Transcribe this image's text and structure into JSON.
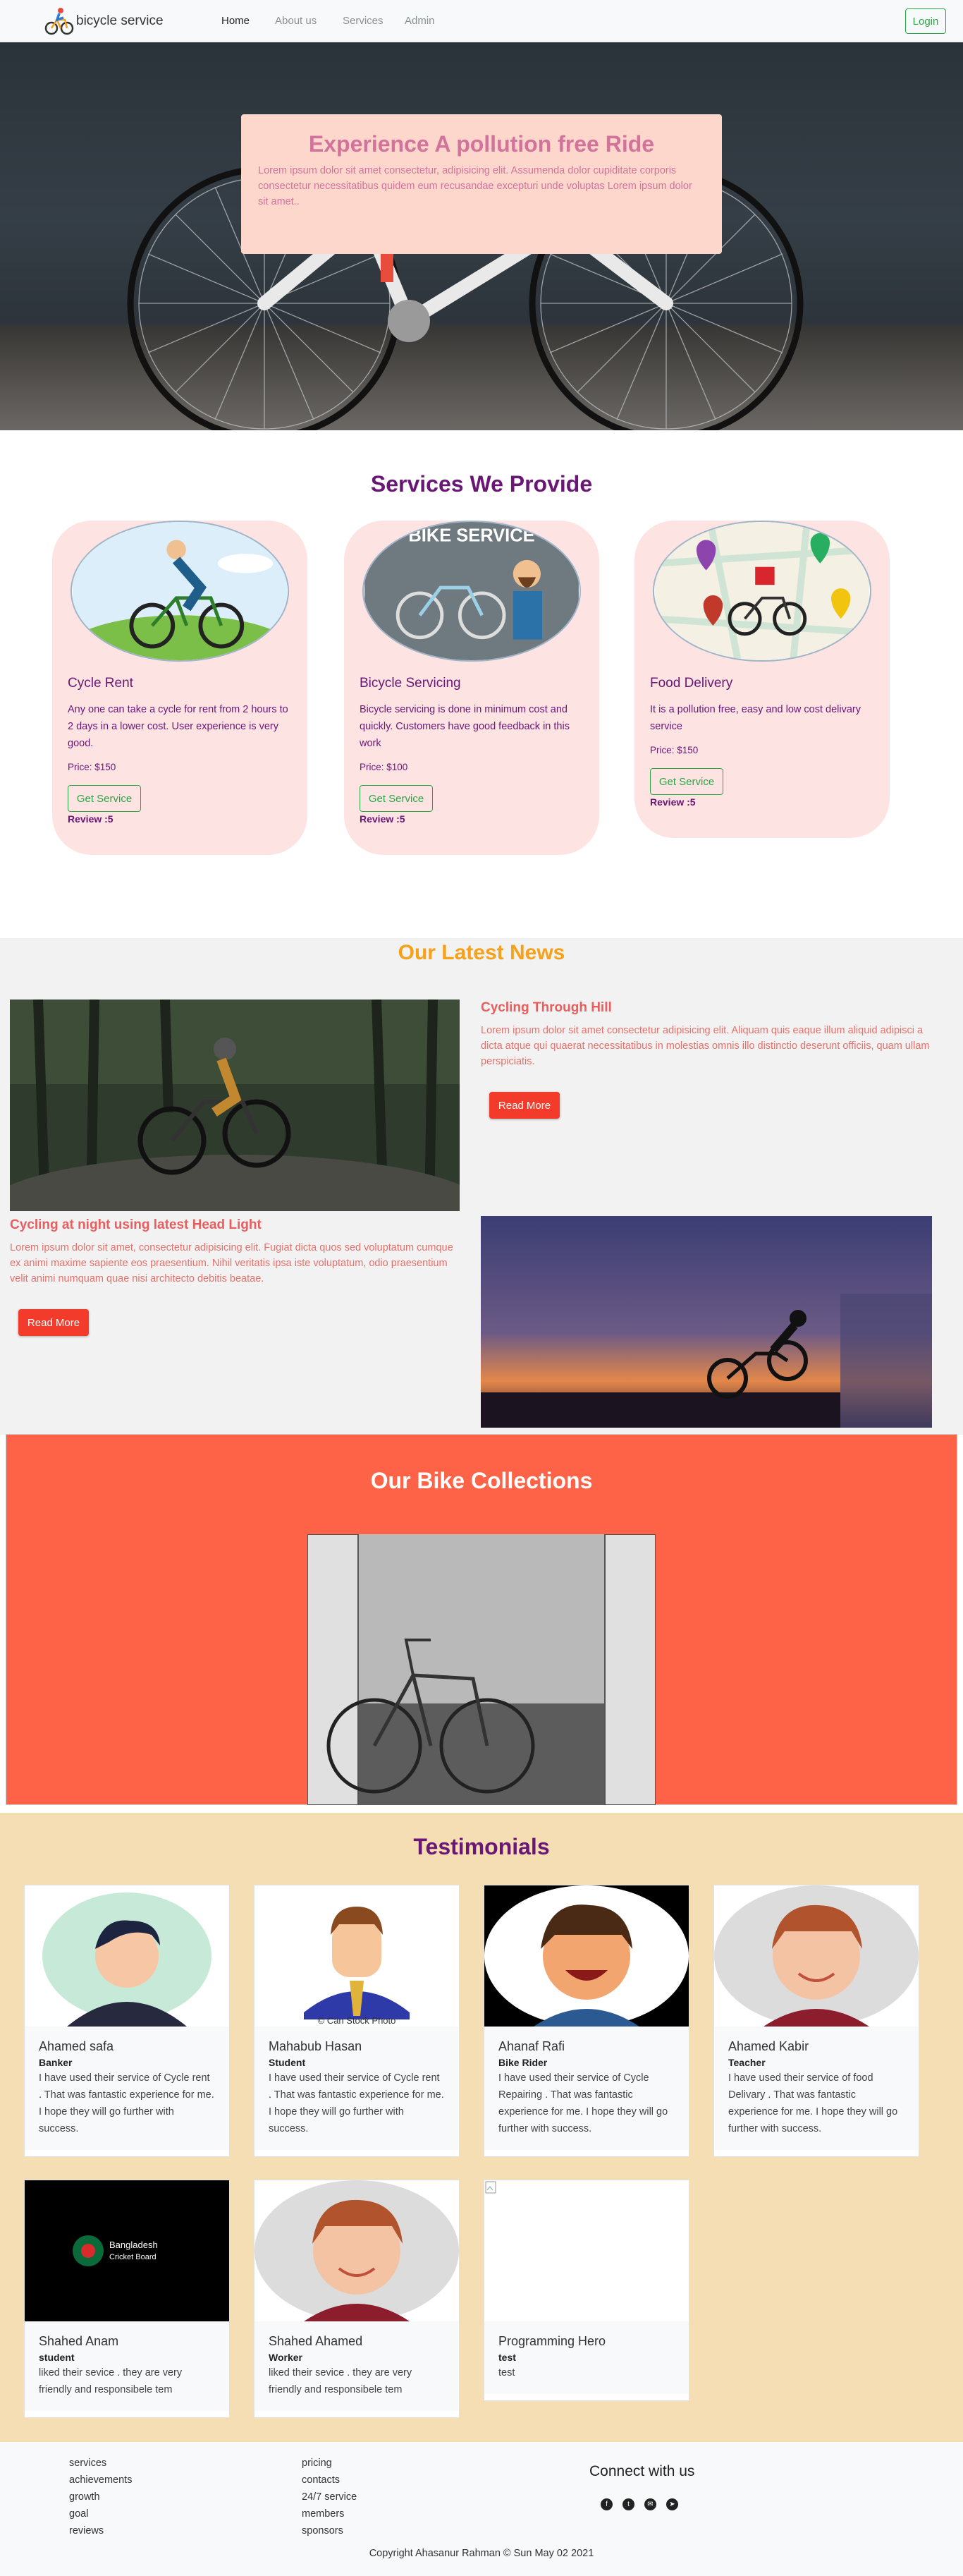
{
  "navbar": {
    "brand": "bicycle service",
    "links": [
      "Home",
      "About us",
      "Services",
      "Admin"
    ],
    "login": "Login"
  },
  "hero": {
    "title": "Experience A pollution free Ride",
    "text": "Lorem ipsum dolor sit amet consectetur, adipisicing elit. Assumenda dolor cupiditate corporis consectetur necessitatibus quidem eum recusandae excepturi unde voluptas Lorem ipsum dolor sit amet.."
  },
  "services": {
    "title": "Services We Provide",
    "image_labels": {
      "servicing": "BIKE SERVICE"
    },
    "items": [
      {
        "name": "Cycle Rent",
        "desc": "Any one can take a cycle for rent from 2 hours to 2 days in a lower cost. User experience is very good.",
        "price": "Price: $150",
        "button": "Get Service",
        "review": "Review :5"
      },
      {
        "name": "Bicycle Servicing",
        "desc": "Bicycle servicing is done in minimum cost and quickly. Customers have good feedback in this work",
        "price": "Price: $100",
        "button": "Get Service",
        "review": "Review :5"
      },
      {
        "name": "Food Delivery",
        "desc": "It is a pollution free, easy and low cost delivary service",
        "price": "Price: $150",
        "button": "Get Service",
        "review": "Review :5"
      }
    ]
  },
  "news": {
    "title": "Our Latest News",
    "items": [
      {
        "heading": "Cycling Through Hill",
        "text": "Lorem ipsum dolor sit amet consectetur adipisicing elit. Aliquam quis eaque illum aliquid adipisci a dicta atque qui quaerat necessitatibus in molestias omnis illo distinctio deserunt officiis, quam ullam perspiciatis.",
        "button": "Read More"
      },
      {
        "heading": "Cycling at night using latest Head Light",
        "text": "Lorem ipsum dolor sit amet, consectetur adipisicing elit. Fugiat dicta quos sed voluptatum cumque ex animi maxime sapiente eos praesentium. Nihil veritatis ipsa iste voluptatum, odio praesentium velit animi numquam quae nisi architecto debitis beatae.",
        "button": "Read More"
      }
    ]
  },
  "collection": {
    "title": "Our Bike Collections"
  },
  "testimonials": {
    "title": "Testimonials",
    "image_labels": {
      "watermark": "© Can Stock Photo",
      "bcb_line1": "Bangladesh",
      "bcb_line2": "Cricket Board"
    },
    "items": [
      {
        "name": "Ahamed safa",
        "role": "Banker",
        "text": "I have used their service of Cycle rent . That was fantastic experience for me. I hope they will go further with success."
      },
      {
        "name": "Mahabub Hasan",
        "role": "Student",
        "text": "I have used their service of Cycle rent . That was fantastic experience for me. I hope they will go further with success."
      },
      {
        "name": "Ahanaf Rafi",
        "role": "Bike Rider",
        "text": "I have used their service of Cycle Repairing . That was fantastic experience for me. I hope they will go further with success."
      },
      {
        "name": "Ahamed Kabir",
        "role": "Teacher",
        "text": "I have used their service of food Delivary . That was fantastic experience for me. I hope they will go further with success."
      },
      {
        "name": "Shahed Anam",
        "role": "student",
        "text": "liked their sevice . they are very friendly and responsibele tem"
      },
      {
        "name": "Shahed Ahamed",
        "role": "Worker",
        "text": "liked their sevice . they are very friendly and responsibele tem"
      },
      {
        "name": "Programming Hero",
        "role": "test",
        "text": "test"
      }
    ]
  },
  "footer": {
    "col1": [
      "services",
      "achievements",
      "growth",
      "goal",
      "reviews"
    ],
    "col2": [
      "pricing",
      "contacts",
      "24/7 service",
      "members",
      "sponsors"
    ],
    "connect": "Connect with us",
    "socials": [
      "facebook-icon",
      "twitter-icon",
      "email-icon",
      "telegram-icon"
    ],
    "copyright": "Copyright Ahasanur Rahman © Sun May 02 2021"
  }
}
